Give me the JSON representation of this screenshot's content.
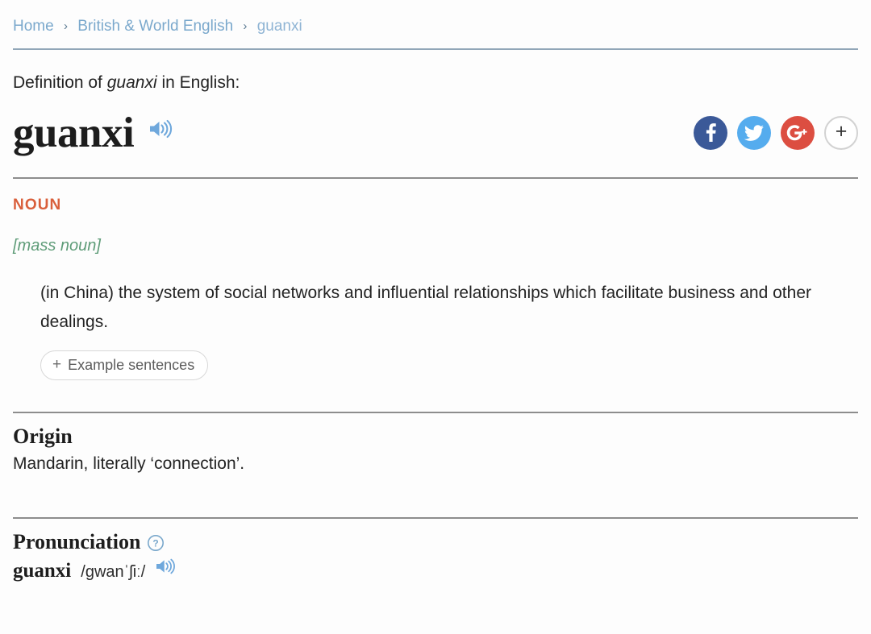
{
  "breadcrumb": {
    "items": [
      {
        "label": "Home",
        "current": false
      },
      {
        "label": "British & World English",
        "current": false
      },
      {
        "label": "guanxi",
        "current": true
      }
    ],
    "separator": "›"
  },
  "definition_heading": {
    "prefix": "Definition of ",
    "word": "guanxi",
    "suffix": " in English:"
  },
  "entry": {
    "headword": "guanxi",
    "audio_icon": "speaker-icon"
  },
  "social": {
    "facebook_label": "f",
    "twitter_label": "twitter-bird",
    "googleplus_label": "G+",
    "more_label": "+",
    "colors": {
      "facebook": "#3b5998",
      "twitter": "#55acee",
      "googleplus": "#dc4e41",
      "more_border": "#d2d2d2"
    }
  },
  "part_of_speech": {
    "label": "NOUN",
    "color": "#d95f3b"
  },
  "grammar_note": "[mass noun]",
  "sense": {
    "text": "(in China) the system of social networks and influential relationships which facilitate business and other dealings.",
    "examples_button": "Example sentences",
    "examples_plus": "+"
  },
  "origin": {
    "heading": "Origin",
    "text": "Mandarin, literally ‘connection’."
  },
  "pronunciation": {
    "heading": "Pronunciation",
    "help_icon": "question-mark-circle-icon",
    "word": "guanxi",
    "ipa": "/gwanˈʃiː/",
    "audio_icon": "speaker-icon"
  }
}
